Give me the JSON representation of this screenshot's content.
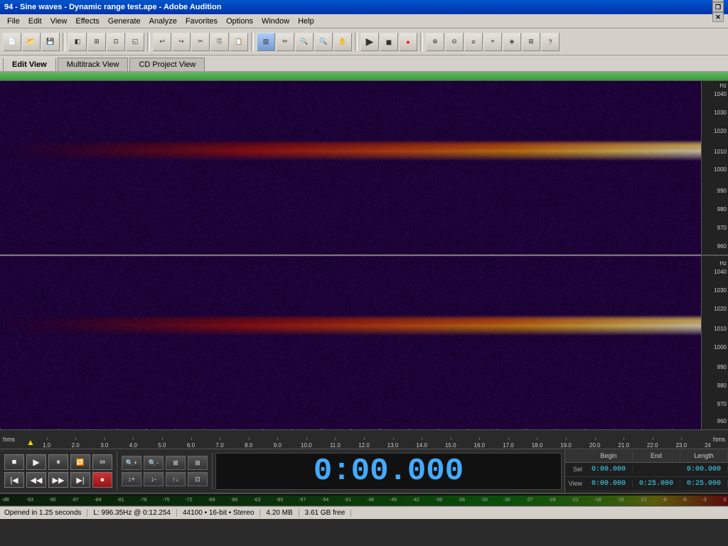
{
  "titleBar": {
    "title": "94 - Sine waves - Dynamic range test.ape - Adobe Audition",
    "controls": [
      "_",
      "❐",
      "✕"
    ]
  },
  "menuBar": {
    "items": [
      "File",
      "Edit",
      "View",
      "Effects",
      "Generate",
      "Analyze",
      "Favorites",
      "Options",
      "Window",
      "Help"
    ]
  },
  "viewTabs": {
    "tabs": [
      "Edit View",
      "Multitrack View",
      "CD Project View"
    ],
    "active": 0
  },
  "timeline": {
    "leftLabel": "hms",
    "rightLabel": "hms",
    "ticks": [
      "1.0",
      "2.0",
      "3.0",
      "4.0",
      "5.0",
      "6.0",
      "7.0",
      "8.0",
      "9.0",
      "10.0",
      "11.0",
      "12.0",
      "13.0",
      "14.0",
      "15.0",
      "16.0",
      "17.0",
      "18.0",
      "19.0",
      "20.0",
      "21.0",
      "22.0",
      "23.0",
      "24.0"
    ]
  },
  "freqLabels": {
    "topPanel": [
      "1040",
      "1030",
      "1020",
      "1010",
      "1000",
      "990",
      "980",
      "970",
      "960"
    ],
    "bottomPanel": [
      "1040",
      "1030",
      "1020",
      "1010",
      "1000",
      "990",
      "980",
      "970",
      "960"
    ],
    "hzTop": "Hz",
    "hzBottom": "Hz"
  },
  "timeDisplay": {
    "value": "0:00.000"
  },
  "position": {
    "headers": [
      "Begin",
      "End",
      "Length"
    ],
    "selLabel": "Sel",
    "viewLabel": "View",
    "selBegin": "0:00.000",
    "selEnd": "",
    "selLength": "0:00.000",
    "viewBegin": "0:00.000",
    "viewEnd": "0:25.000",
    "viewLength": "0:25.000"
  },
  "levelBar": {
    "labels": [
      "-dB",
      "-93",
      "-90",
      "-87",
      "-84",
      "-81",
      "-78",
      "-75",
      "-72",
      "-69",
      "-66",
      "-63",
      "-60",
      "-57",
      "-54",
      "-51",
      "-48",
      "-45",
      "-42",
      "-39",
      "-36",
      "-33",
      "-30",
      "-27",
      "-24",
      "-21",
      "-18",
      "-15",
      "-12",
      "-9",
      "-6",
      "-3",
      "0"
    ]
  },
  "statusBar": {
    "openedText": "Opened in 1.25 seconds",
    "freqText": "L: 996.35Hz @ 0:12.254",
    "formatText": "44100 • 16-bit • Stereo",
    "sizeText": "4.20 MB",
    "freeText": "3.61 GB free"
  }
}
